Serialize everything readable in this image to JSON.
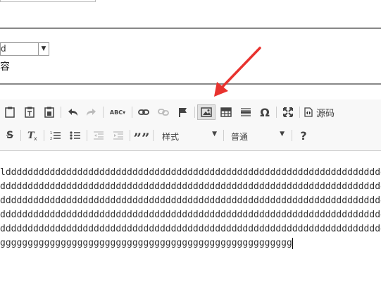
{
  "form": {
    "select_value": "d",
    "caption": "容"
  },
  "toolbar": {
    "style_combo": "样式",
    "format_combo": "普通",
    "source_label": "源码",
    "help_label": "?",
    "spellcheck_label": "ABC",
    "omega_label": "Ω",
    "bold_strike_label": "S",
    "quote_label": "””"
  },
  "editor": {
    "lines": [
      "ldddddddddddddddddddddddddddddddddddddddddddddddddddddddddddddddddddddd",
      "ddddddddddddddddddddddddddddddddddddddddddddddddddddddddddddddddddddddd",
      "ddddddddddddddddddddddddddddddddddddddddddddddddddddddddddddddddddddddd",
      "ddddddddddddddddddddddddddddddddddddddddddddddddddddddddddddddddddddddd",
      "ddddddddddddddddddddddddddddddddddddddddddddddddddddddddddddddddddddddd",
      "ggggggggggggggggggggggggggggggggggggggggggggggggggggg"
    ]
  },
  "colors": {
    "annotation_arrow": "#e8322e"
  }
}
